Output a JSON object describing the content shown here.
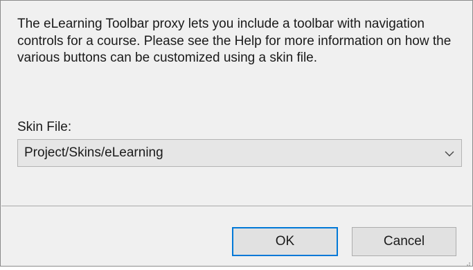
{
  "dialog": {
    "description": "The eLearning Toolbar proxy lets you include a toolbar with navigation controls for a course. Please see the Help for more information on how the various buttons can be customized using a skin file.",
    "skin_file_label": "Skin File:",
    "skin_file_value": "Project/Skins/eLearning",
    "dropdown_icon": "chevron-down-icon",
    "ok_label": "OK",
    "cancel_label": "Cancel"
  },
  "colors": {
    "dialog_background": "#f0f0f0",
    "default_button_border": "#0078d7"
  }
}
